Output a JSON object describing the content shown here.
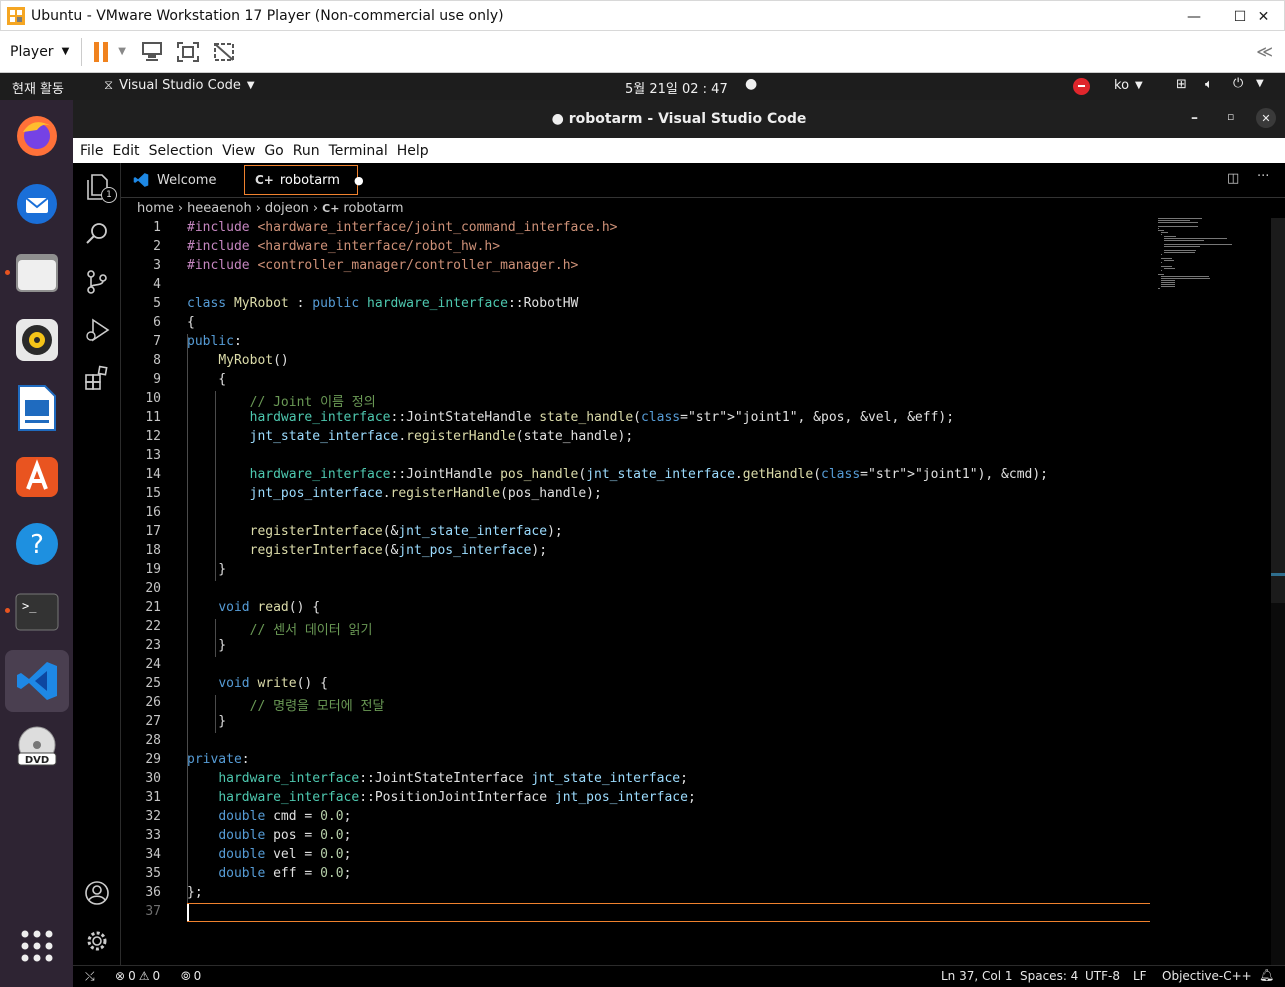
{
  "vmware": {
    "title": "Ubuntu - VMware Workstation 17 Player (Non-commercial use only)",
    "player_label": "Player"
  },
  "topbar": {
    "activities": "현재 활동",
    "app_name": "Visual Studio Code",
    "clock": "5월 21일  02 : 47",
    "lang": "ko"
  },
  "vscode": {
    "title": "● robotarm - Visual Studio Code",
    "menu": [
      "File",
      "Edit",
      "Selection",
      "View",
      "Go",
      "Run",
      "Terminal",
      "Help"
    ],
    "tabs": [
      {
        "label": "Welcome",
        "active": false
      },
      {
        "label": "robotarm",
        "active": true,
        "dirty": true
      }
    ],
    "explorer_badge": "1",
    "breadcrumb": [
      "home",
      "heeaenoh",
      "dojeon",
      "robotarm"
    ],
    "code_lines": [
      "#include <hardware_interface/joint_command_interface.h>",
      "#include <hardware_interface/robot_hw.h>",
      "#include <controller_manager/controller_manager.h>",
      "",
      "class MyRobot : public hardware_interface::RobotHW",
      "{",
      "public:",
      "    MyRobot()",
      "    {",
      "        // Joint 이름 정의",
      "        hardware_interface::JointStateHandle state_handle(\"joint1\", &pos, &vel, &eff);",
      "        jnt_state_interface.registerHandle(state_handle);",
      "",
      "        hardware_interface::JointHandle pos_handle(jnt_state_interface.getHandle(\"joint1\"), &cmd);",
      "        jnt_pos_interface.registerHandle(pos_handle);",
      "",
      "        registerInterface(&jnt_state_interface);",
      "        registerInterface(&jnt_pos_interface);",
      "    }",
      "",
      "    void read() {",
      "        // 센서 데이터 읽기",
      "    }",
      "",
      "    void write() {",
      "        // 명령을 모터에 전달",
      "    }",
      "",
      "private:",
      "    hardware_interface::JointStateInterface jnt_state_interface;",
      "    hardware_interface::PositionJointInterface jnt_pos_interface;",
      "    double cmd = 0.0;",
      "    double pos = 0.0;",
      "    double vel = 0.0;",
      "    double eff = 0.0;",
      "};",
      ""
    ],
    "status": {
      "errors": "0",
      "warnings": "0",
      "ports": "0",
      "position": "Ln 37, Col 1",
      "spaces": "Spaces: 4",
      "encoding": "UTF-8",
      "eol": "LF",
      "language": "Objective-C++"
    }
  },
  "dock": {
    "apps": [
      "firefox-icon",
      "thunderbird-icon",
      "files-icon",
      "rhythmbox-icon",
      "writer-icon",
      "app-center-icon",
      "help-icon",
      "terminal-icon",
      "vscode-icon",
      "dvd-icon"
    ]
  }
}
